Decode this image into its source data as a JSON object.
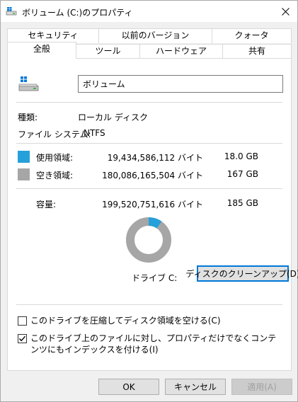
{
  "window": {
    "title": "ボリューム (C:)のプロパティ"
  },
  "tabs": {
    "row1": [
      "セキュリティ",
      "以前のバージョン",
      "クォータ"
    ],
    "row2": [
      "全般",
      "ツール",
      "ハードウェア",
      "共有"
    ],
    "selected": "全般"
  },
  "general": {
    "volume_name": "ボリューム",
    "type_label": "種類:",
    "type_value": "ローカル ディスク",
    "fs_label": "ファイル システム:",
    "fs_value": "NTFS",
    "used": {
      "label": "使用領域:",
      "bytes": "19,434,586,112 バイト",
      "size": "18.0 GB",
      "color": "#26a0da"
    },
    "free": {
      "label": "空き領域:",
      "bytes": "180,086,165,504 バイト",
      "size": "167 GB",
      "color": "#a6a6a6"
    },
    "capacity": {
      "label": "容量:",
      "bytes": "199,520,751,616 バイト",
      "size": "185 GB"
    },
    "used_fraction": 0.0974,
    "drive_label": "ドライブ C:",
    "cleanup_button": "ディスクのクリーンアップ(D)",
    "compress_checkbox": {
      "label": "このドライブを圧縮してディスク領域を空ける(C)",
      "checked": false
    },
    "index_checkbox": {
      "label": "このドライブ上のファイルに対し、プロパティだけでなくコンテンツにもインデックスを付ける(I)",
      "checked": true
    }
  },
  "footer": {
    "ok": "OK",
    "cancel": "キャンセル",
    "apply": "適用(A)"
  }
}
